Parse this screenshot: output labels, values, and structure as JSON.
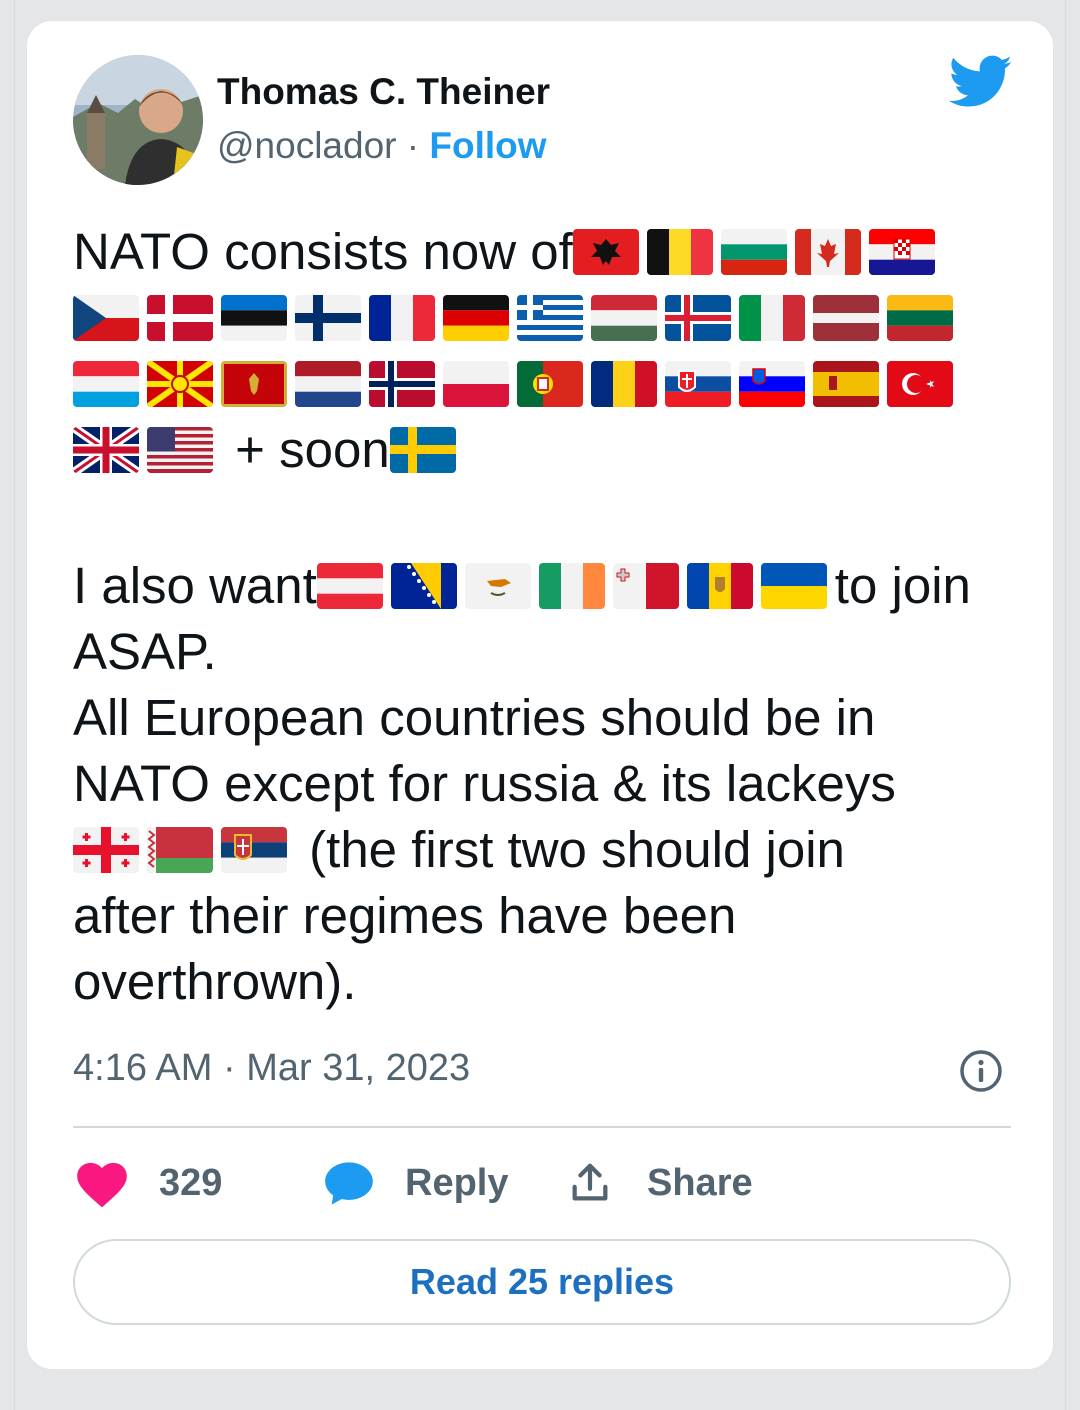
{
  "author": {
    "name": "Thomas C. Theiner",
    "handle": "@noclador",
    "separator": "·",
    "follow_label": "Follow"
  },
  "tweet": {
    "line1_text": "NATO consists now of",
    "line1_flags": [
      "Albania",
      "Belgium",
      "Bulgaria",
      "Canada",
      "Croatia"
    ],
    "line2_flags": [
      "Czechia",
      "Denmark",
      "Estonia",
      "Finland",
      "France",
      "Germany",
      "Greece",
      "Hungary",
      "Iceland",
      "Italy",
      "Latvia",
      "Lithuania"
    ],
    "line3_flags": [
      "Luxembourg",
      "North Macedonia",
      "Montenegro",
      "Netherlands",
      "Norway",
      "Poland",
      "Portugal",
      "Romania",
      "Slovakia",
      "Slovenia",
      "Spain",
      "Turkey"
    ],
    "line4_flags": [
      "United Kingdom",
      "United States"
    ],
    "line4_text": " + soon",
    "line4_after_flags": [
      "Sweden"
    ],
    "line6_text_a": "I also want",
    "line6_flags": [
      "Austria",
      "Bosnia and Herzegovina",
      "Cyprus",
      "Ireland",
      "Malta",
      "Moldova",
      "Ukraine"
    ],
    "line6_text_b": "to join",
    "line7": "ASAP.",
    "line8": "All European countries should be in",
    "line9": "NATO except for russia & its lackeys",
    "line10_flags": [
      "Georgia",
      "Belarus",
      "Serbia"
    ],
    "line10_text": " (the first two should join",
    "line11": "after their regimes have been",
    "line12": "overthrown)."
  },
  "timestamp": "4:16 AM · Mar 31, 2023",
  "actions": {
    "likes_count": "329",
    "reply_label": "Reply",
    "share_label": "Share"
  },
  "read_replies_label": "Read 25 replies",
  "colors": {
    "brand": "#1d9bf0",
    "heart": "#f91880",
    "reply_bubble": "#1d9bf0",
    "muted_text": "#536471"
  }
}
